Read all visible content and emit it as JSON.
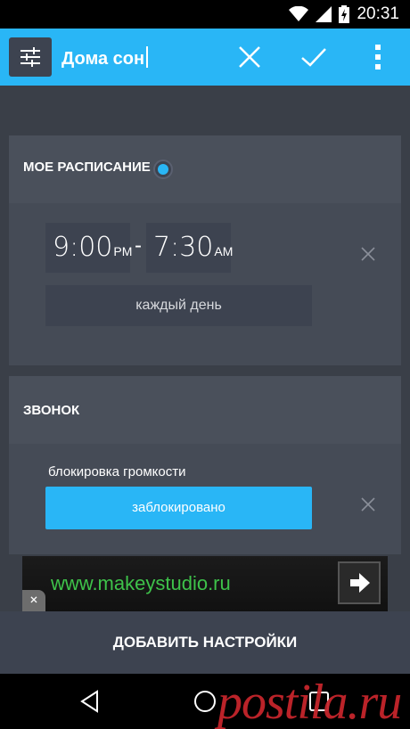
{
  "status_bar": {
    "time": "20:31",
    "battery_icon": "battery-charging-icon",
    "wifi_icon": "wifi-icon",
    "signal_icon": "signal-icon"
  },
  "action_bar": {
    "profile_name": "Дома сон",
    "menu_icon": "sliders-icon",
    "cancel_icon": "close-icon",
    "confirm_icon": "checkmark-icon",
    "overflow_icon": "more-vertical-icon",
    "accent_color": "#29b6f6"
  },
  "schedule_card": {
    "title": "МОЕ РАСПИСАНИЕ",
    "radio_selected": true,
    "start_time": "9:00",
    "start_ampm": "PM",
    "separator": "-",
    "end_time": "7:30",
    "end_ampm": "AM",
    "repeat_label": "каждый день"
  },
  "ringer_card": {
    "title": "ЗВОНОК",
    "setting_label": "блокировка громкости",
    "setting_value": "заблокировано"
  },
  "ad_banner": {
    "text": "www.makeystudio.ru",
    "close_label": "×"
  },
  "footer": {
    "add_settings_label": "ДОБАВИТЬ НАСТРОЙКИ"
  },
  "watermark": {
    "text": "postila.ru"
  }
}
